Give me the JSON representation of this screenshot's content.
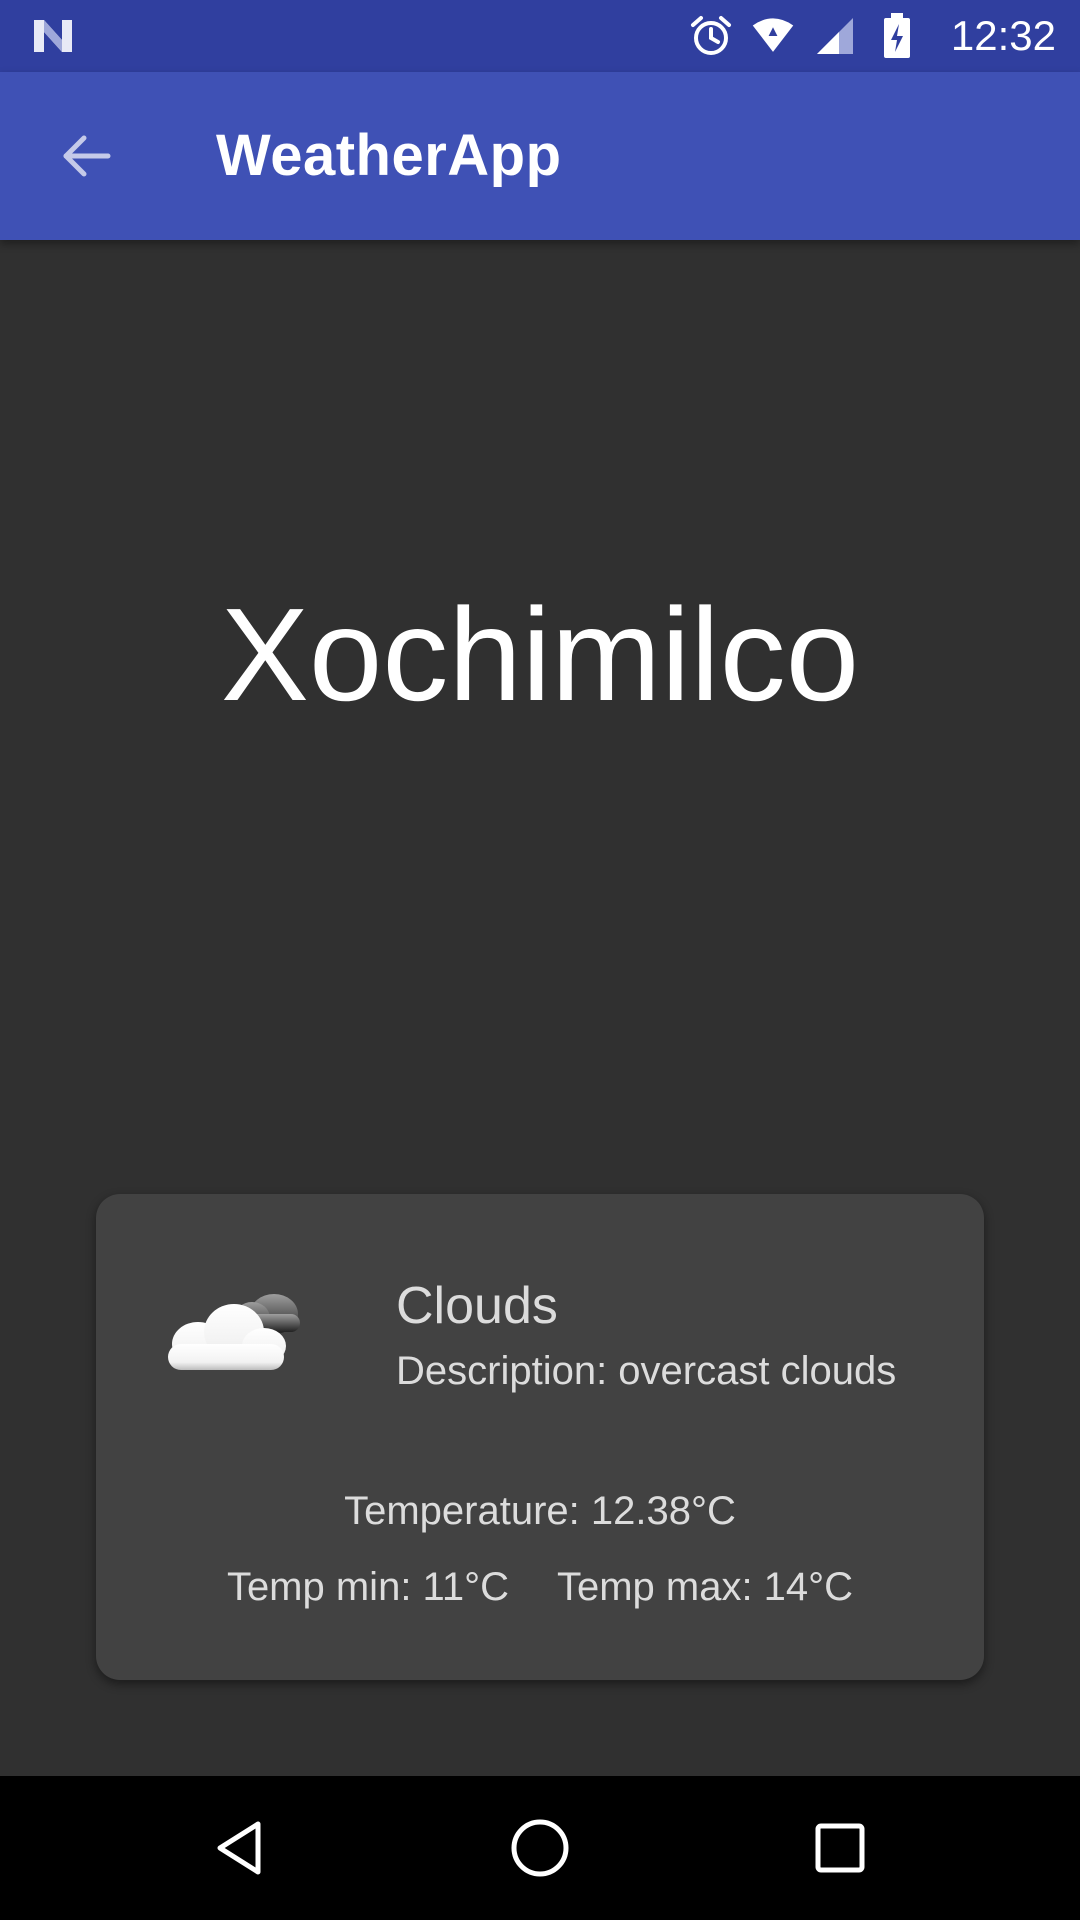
{
  "status_bar": {
    "time": "12:32",
    "icons": [
      "notification-n-icon",
      "alarm-icon",
      "wifi-icon",
      "cell-signal-icon",
      "battery-charging-icon"
    ],
    "background": "#303F9F"
  },
  "app_bar": {
    "title": "WeatherApp",
    "back_icon": "arrow-back-icon",
    "background": "#3F51B5"
  },
  "city": {
    "name": "Xochimilco"
  },
  "weather_card": {
    "icon": "cloudy-icon",
    "main": "Clouds",
    "description": "Description: overcast clouds",
    "temperature": "Temperature: 12.38°C",
    "temp_min": "Temp min: 11°C",
    "temp_max": "Temp max: 14°C",
    "background": "#424242"
  },
  "nav_bar": {
    "buttons": [
      "nav-back-icon",
      "nav-home-icon",
      "nav-recents-icon"
    ]
  },
  "colors": {
    "screen_background": "#303030",
    "text_primary": "#ffffff",
    "text_secondary": "#dcdcdc"
  }
}
